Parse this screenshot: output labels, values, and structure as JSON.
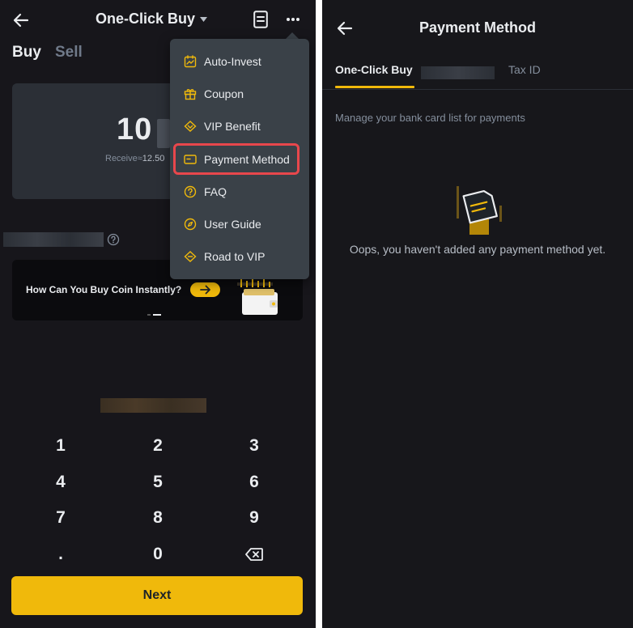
{
  "left": {
    "header": {
      "title": "One-Click Buy"
    },
    "tabs": {
      "buy": "Buy",
      "sell": "Sell"
    },
    "amount": {
      "value": "10",
      "receive_label": "Receive≈",
      "receive_value": "12.50"
    },
    "banner": {
      "text": "How Can You Buy Coin Instantly?"
    },
    "keypad": [
      "1",
      "2",
      "3",
      "4",
      "5",
      "6",
      "7",
      "8",
      "9",
      ".",
      "0"
    ],
    "next_label": "Next",
    "menu": {
      "items": [
        {
          "label": "Auto-Invest",
          "icon": "auto-invest-icon"
        },
        {
          "label": "Coupon",
          "icon": "gift-icon"
        },
        {
          "label": "VIP Benefit",
          "icon": "vip-icon"
        },
        {
          "label": "Payment Method",
          "icon": "card-icon"
        },
        {
          "label": "FAQ",
          "icon": "question-icon"
        },
        {
          "label": "User Guide",
          "icon": "compass-icon"
        },
        {
          "label": "Road to VIP",
          "icon": "vip-road-icon"
        }
      ],
      "highlighted": "Payment Method"
    }
  },
  "right": {
    "title": "Payment Method",
    "tabs": {
      "active": "One-Click Buy",
      "second": "Tax ID"
    },
    "description": "Manage your bank card list for payments",
    "empty_message": "Oops, you haven't added any payment method yet."
  },
  "colors": {
    "background": "#17161b",
    "accent": "#f0b90b",
    "card": "#2b2f36",
    "menu": "#3a4148",
    "highlight": "#e8474c"
  }
}
